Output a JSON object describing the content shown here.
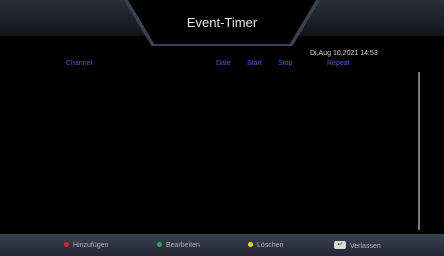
{
  "header": {
    "title": "Event-Timer",
    "datetime": "Di,Aug 10,2021 14:53"
  },
  "columns": {
    "channel": "Channel",
    "date": "Date",
    "start": "Start",
    "stop": "Stop",
    "repeat": "Repeat"
  },
  "timers": [],
  "footer": {
    "add": {
      "label": "Hinzufügen",
      "color": "#e02020"
    },
    "edit": {
      "label": "Bearbeiten",
      "color": "#2ea84a"
    },
    "delete": {
      "label": "Löschen",
      "color": "#f2d21a"
    },
    "exit": {
      "label": "Verlassen",
      "icon": "back-key-icon"
    }
  },
  "colors": {
    "accent": "#3f62c8",
    "background": "#000000"
  }
}
